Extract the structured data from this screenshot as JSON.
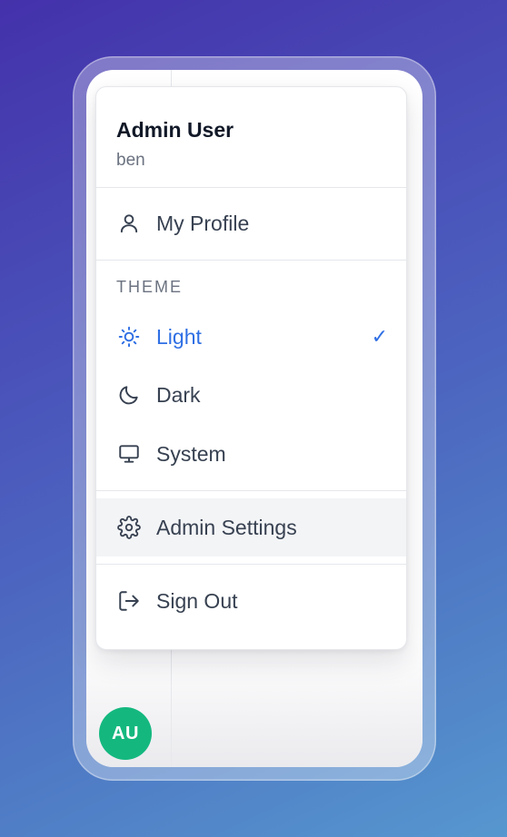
{
  "user": {
    "name": "Admin User",
    "handle": "ben",
    "avatar_initials": "AU",
    "avatar_color": "#14b87f"
  },
  "menu": {
    "profile_label": "My Profile",
    "theme_section_label": "THEME",
    "theme_options": [
      {
        "label": "Light",
        "icon": "sun-icon",
        "selected": true
      },
      {
        "label": "Dark",
        "icon": "moon-icon",
        "selected": false
      },
      {
        "label": "System",
        "icon": "monitor-icon",
        "selected": false
      }
    ],
    "selected_mark": "✓",
    "admin_settings_label": "Admin Settings",
    "sign_out_label": "Sign Out"
  },
  "colors": {
    "accent": "#2f6fe4",
    "text": "#374151",
    "muted": "#6b7280",
    "hover_bg": "#f3f4f6"
  }
}
